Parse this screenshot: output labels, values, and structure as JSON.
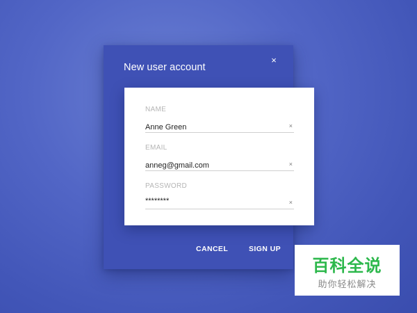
{
  "dialog": {
    "title": "New user account",
    "close_icon": "close-icon",
    "close_glyph": "×"
  },
  "form": {
    "fields": [
      {
        "label": "NAME",
        "value": "Anne Green",
        "clear_glyph": "×"
      },
      {
        "label": "EMAIL",
        "value": "anneg@gmail.com",
        "clear_glyph": "×"
      },
      {
        "label": "PASSWORD",
        "value": "********",
        "clear_glyph": "×"
      }
    ]
  },
  "actions": {
    "cancel_label": "CANCEL",
    "signup_label": "SIGN UP"
  },
  "watermark": {
    "title": "百科全说",
    "subtitle": "助你轻松解决"
  },
  "colors": {
    "background": "#4a5fc1",
    "dialog": "#3f51b5",
    "card": "#ffffff",
    "label": "#b5b5b5",
    "watermark_green": "#2db84c"
  }
}
